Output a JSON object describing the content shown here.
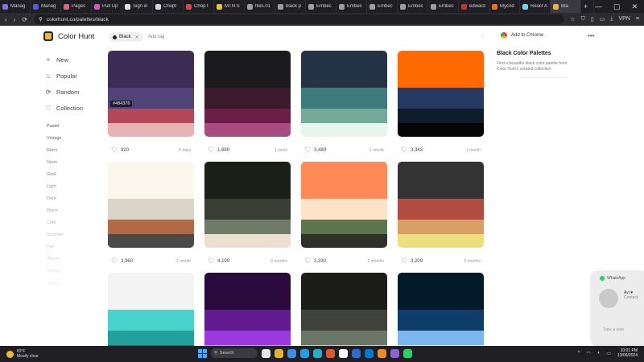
{
  "browser": {
    "tabs": [
      {
        "label": "Manag",
        "color": "#7b6cf6"
      },
      {
        "label": "Manag",
        "color": "#4e5bf0"
      },
      {
        "label": "Pages",
        "color": "#f25a7a"
      },
      {
        "label": "Pull Up",
        "color": "#e84fbd"
      },
      {
        "label": "Sign in",
        "color": "#e0e0e0"
      },
      {
        "label": "Chopt",
        "color": "#cfd8dc"
      },
      {
        "label": "Chop t",
        "color": "#ea4335"
      },
      {
        "label": "MTN S",
        "color": "#f2c500"
      },
      {
        "label": "files.01",
        "color": "#9e9e9e"
      },
      {
        "label": "black p",
        "color": "#9e9e9e"
      },
      {
        "label": "Embec",
        "color": "#9e9e9e"
      },
      {
        "label": "Embec",
        "color": "#9e9e9e"
      },
      {
        "label": "Embec",
        "color": "#9e9e9e"
      },
      {
        "label": "Embec",
        "color": "#9e9e9e"
      },
      {
        "label": "Embec",
        "color": "#9e9e9e"
      },
      {
        "label": "edward",
        "color": "#d32f2f"
      },
      {
        "label": "Mycod",
        "color": "#ff6d00"
      },
      {
        "label": "React A",
        "color": "#61dafb"
      },
      {
        "label": "Bla",
        "color": "#f3b52a"
      }
    ],
    "active_tab_index": 18,
    "url": "colorhunt.co/palettes/black",
    "vpn_label": "VPN"
  },
  "site": {
    "brand": "Color Hunt",
    "search_chip": "Black",
    "search_placeholder": "Add tag",
    "add_to_chrome": "Add to Chrome",
    "nav": [
      {
        "label": "New",
        "icon": "sparkle-icon",
        "glyph": "✧"
      },
      {
        "label": "Popular",
        "icon": "flame-icon",
        "glyph": "♨"
      },
      {
        "label": "Random",
        "icon": "random-icon",
        "glyph": "⟳"
      },
      {
        "label": "Collection",
        "icon": "heart-icon",
        "glyph": "♡"
      }
    ],
    "tags": [
      {
        "label": "Pastel",
        "color": "#555"
      },
      {
        "label": "Vintage",
        "color": "#666"
      },
      {
        "label": "Retro",
        "color": "#777"
      },
      {
        "label": "Neon",
        "color": "#888"
      },
      {
        "label": "Gold",
        "color": "#888"
      },
      {
        "label": "Light",
        "color": "#999"
      },
      {
        "label": "Dark",
        "color": "#999"
      },
      {
        "label": "Warm",
        "color": "#aaa"
      },
      {
        "label": "Cold",
        "color": "#bbb"
      },
      {
        "label": "Summer",
        "color": "#c4c4c4"
      },
      {
        "label": "Fall",
        "color": "#cecece"
      },
      {
        "label": "Winter",
        "color": "#d8d8d8"
      },
      {
        "label": "Spring",
        "color": "#e2e2e2"
      },
      {
        "label": "Happy",
        "color": "#ececec"
      }
    ]
  },
  "palettes": [
    {
      "colors": [
        "#3d2d55",
        "#4f4377",
        "#b3485a",
        "#e6b4b4"
      ],
      "likes": "920",
      "ago": "5 days",
      "hex_label": "#484376"
    },
    {
      "colors": [
        "#1b1b1e",
        "#3b1a2b",
        "#6c1d48",
        "#a84b7e"
      ],
      "likes": "1,689",
      "ago": "1 week"
    },
    {
      "colors": [
        "#243345",
        "#3e7b7c",
        "#74aa98",
        "#e8f5ee"
      ],
      "likes": "3,489",
      "ago": "1 month"
    },
    {
      "colors": [
        "#ff6a00",
        "#263a63",
        "#0e1c2c",
        "#050505"
      ],
      "likes": "3,343",
      "ago": "1 month"
    },
    {
      "colors": [
        "#fbf7ed",
        "#dad5c7",
        "#b26a45",
        "#4a4a4a"
      ],
      "likes": "3,960",
      "ago": "1 month"
    },
    {
      "colors": [
        "#1b1f17",
        "#3a3d33",
        "#6f7a69",
        "#ecdfcf"
      ],
      "likes": "4,199",
      "ago": "2 months"
    },
    {
      "colors": [
        "#ff8957",
        "#fee3c8",
        "#5e7650",
        "#2f3029"
      ],
      "likes": "2,330",
      "ago": "2 months"
    },
    {
      "colors": [
        "#333334",
        "#b14c41",
        "#d9a063",
        "#eedf7e"
      ],
      "likes": "3,209",
      "ago": "2 months"
    },
    {
      "colors": [
        "#f3f3f3",
        "#4ad2cc",
        "#22a19a",
        "#1b6e69"
      ],
      "likes": "",
      "ago": ""
    },
    {
      "colors": [
        "#2a0a3d",
        "#611c92",
        "#9b3ae0",
        "#c996f7"
      ],
      "likes": "",
      "ago": ""
    },
    {
      "colors": [
        "#1c1d1b",
        "#3f423a",
        "#6d7767",
        "#c9d0c0"
      ],
      "likes": "",
      "ago": ""
    },
    {
      "colors": [
        "#021a2a",
        "#0d3b6a",
        "#7cb7f0",
        "#dff0ff"
      ],
      "likes": "",
      "ago": ""
    }
  ],
  "sidebar": {
    "title": "Black Color Palettes",
    "desc": "Find a beautiful black color palette from Color Hunt's curated collection"
  },
  "whatsapp": {
    "title": "WhatsApp",
    "name": "Avi ♥",
    "status": "Contact",
    "placeholder": "Type a note"
  },
  "taskbar": {
    "weather_temp": "83°F",
    "weather_desc": "Mostly clear",
    "search": "Search",
    "time": "10:01 PM",
    "date": "13/06/2024",
    "apps": [
      "#e9e9e9",
      "#e6b32a",
      "#3a8ee6",
      "#1fa0e4",
      "#20b1c9",
      "#e2562c",
      "#ffffff",
      "#2f6ad4",
      "#0078d4",
      "#f08a24",
      "#8c63d6",
      "#25d366"
    ]
  }
}
